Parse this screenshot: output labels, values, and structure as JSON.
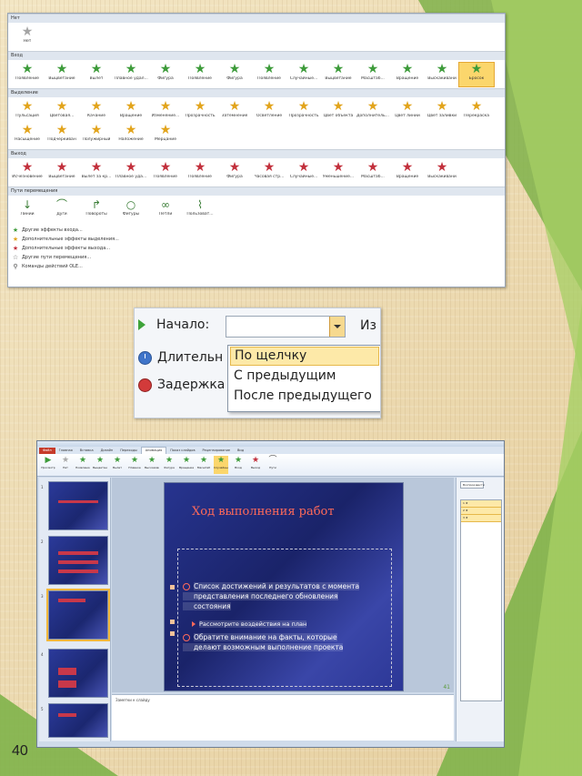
{
  "gallery": {
    "sections": [
      {
        "title": "Нет",
        "items": [
          {
            "label": "Нет",
            "icon": "star-gray"
          }
        ]
      },
      {
        "title": "Вход",
        "items": [
          {
            "label": "Появление",
            "icon": "star-green"
          },
          {
            "label": "Выцветание",
            "icon": "star-green"
          },
          {
            "label": "Вылет",
            "icon": "star-green"
          },
          {
            "label": "Плавное удал...",
            "icon": "star-green"
          },
          {
            "label": "Фигура",
            "icon": "star-green"
          },
          {
            "label": "Появление",
            "icon": "star-green"
          },
          {
            "label": "Фигура",
            "icon": "star-green"
          },
          {
            "label": "Появление",
            "icon": "star-green"
          },
          {
            "label": "Случайные...",
            "icon": "star-green"
          },
          {
            "label": "Выцветание",
            "icon": "star-green"
          },
          {
            "label": "Масштаб...",
            "icon": "star-green"
          },
          {
            "label": "Вращение",
            "icon": "star-green"
          },
          {
            "label": "Выскакивани",
            "icon": "star-green"
          },
          {
            "label": "Бросок",
            "icon": "star-green"
          }
        ]
      },
      {
        "title": "Выделение",
        "items": [
          {
            "label": "Пульсация",
            "icon": "star-gold"
          },
          {
            "label": "Цветовая...",
            "icon": "star-gold"
          },
          {
            "label": "Качание",
            "icon": "star-gold"
          },
          {
            "label": "Вращение",
            "icon": "star-gold"
          },
          {
            "label": "Изменение...",
            "icon": "star-gold"
          },
          {
            "label": "Прозрачность",
            "icon": "star-gold"
          },
          {
            "label": "Затемнение",
            "icon": "star-gold"
          },
          {
            "label": "Осветление",
            "icon": "star-gold"
          },
          {
            "label": "Прозрачность",
            "icon": "star-gold"
          },
          {
            "label": "Цвет объекта",
            "icon": "star-gold"
          },
          {
            "label": "Дополнитель...",
            "icon": "star-gold"
          },
          {
            "label": "Цвет линии",
            "icon": "star-gold"
          },
          {
            "label": "Цвет заливки",
            "icon": "star-gold"
          },
          {
            "label": "Перекраска",
            "icon": "star-gold"
          },
          {
            "label": "Насыщение",
            "icon": "star-gold"
          },
          {
            "label": "Подчеркиван",
            "icon": "star-gold"
          },
          {
            "label": "Полужирный",
            "icon": "star-gold"
          },
          {
            "label": "Наложение",
            "icon": "star-gold"
          },
          {
            "label": "Мерцание",
            "icon": "star-gold"
          }
        ]
      },
      {
        "title": "Выход",
        "items": [
          {
            "label": "Исчезновение",
            "icon": "star-red"
          },
          {
            "label": "Выцветание",
            "icon": "star-red"
          },
          {
            "label": "Вылет за кр...",
            "icon": "star-red"
          },
          {
            "label": "Плавное уда...",
            "icon": "star-red"
          },
          {
            "label": "Появление",
            "icon": "star-red"
          },
          {
            "label": "Появление",
            "icon": "star-red"
          },
          {
            "label": "Фигура",
            "icon": "star-red"
          },
          {
            "label": "Часовая стр...",
            "icon": "star-red"
          },
          {
            "label": "Случайные...",
            "icon": "star-red"
          },
          {
            "label": "Уменьшение...",
            "icon": "star-red"
          },
          {
            "label": "Масштаб...",
            "icon": "star-red"
          },
          {
            "label": "Вращение",
            "icon": "star-red"
          },
          {
            "label": "Выскакивани",
            "icon": "star-red"
          }
        ]
      },
      {
        "title": "Пути перемещения",
        "items": [
          {
            "label": "Линии",
            "icon": "path-line"
          },
          {
            "label": "Дуги",
            "icon": "path-arc"
          },
          {
            "label": "Повороты",
            "icon": "path-turn"
          },
          {
            "label": "Фигуры",
            "icon": "path-shape"
          },
          {
            "label": "Петли",
            "icon": "path-loop"
          },
          {
            "label": "Пользоват...",
            "icon": "path-custom"
          }
        ]
      }
    ],
    "links": [
      {
        "label": "Другие эффекты входа...",
        "icon": "star-green"
      },
      {
        "label": "Дополнительные эффекты выделения...",
        "icon": "star-gold"
      },
      {
        "label": "Дополнительные эффекты выхода...",
        "icon": "star-red"
      },
      {
        "label": "Другие пути перемещения...",
        "icon": "path-icon"
      },
      {
        "label": "Команды действий OLE...",
        "icon": "ole-icon"
      }
    ]
  },
  "timing": {
    "start_label": "Начало:",
    "duration_label": "Длительн",
    "delay_label": "Задержка",
    "cut_label": "Из",
    "options": [
      "По щелчку",
      "С предыдущим",
      "После предыдущего"
    ],
    "selected_option": "По щелчку"
  },
  "ppt": {
    "tabs": [
      "Файл",
      "Главная",
      "Вставка",
      "Дизайн",
      "Переходы",
      "Анимация",
      "Показ слайдов",
      "Рецензирование",
      "Вид"
    ],
    "active_tab": "Анимация",
    "ribbon_buttons": [
      "Просмотр",
      "Нет",
      "Появление",
      "Выцветание",
      "Вылет",
      "Плавное",
      "Выскакивание",
      "Фигура",
      "Вращение",
      "Масштаб",
      "Случайные",
      "Вход",
      "Выход",
      "Пути"
    ],
    "slide": {
      "title": "Ход выполнения работ",
      "bullet_1_line_1": "Список достижений и результатов с момента",
      "bullet_1_line_2": "представления последнего обновления",
      "bullet_1_line_3": "состояния",
      "sub_bullet": "Рассмотрите воздействия на план",
      "bullet_2_line_1": "Обратите внимание на факты, которые",
      "bullet_2_line_2": "делают возможным выполнение проекта",
      "number": "41"
    },
    "notes_placeholder": "Заметки к слайду",
    "pane_button": "Воспроизвести"
  },
  "page_number": "40",
  "colors": {
    "accent_green": "#7fb24a",
    "slide_blue": "#27348f",
    "slide_title": "#ff6a5a",
    "highlight": "#fbd66c"
  }
}
